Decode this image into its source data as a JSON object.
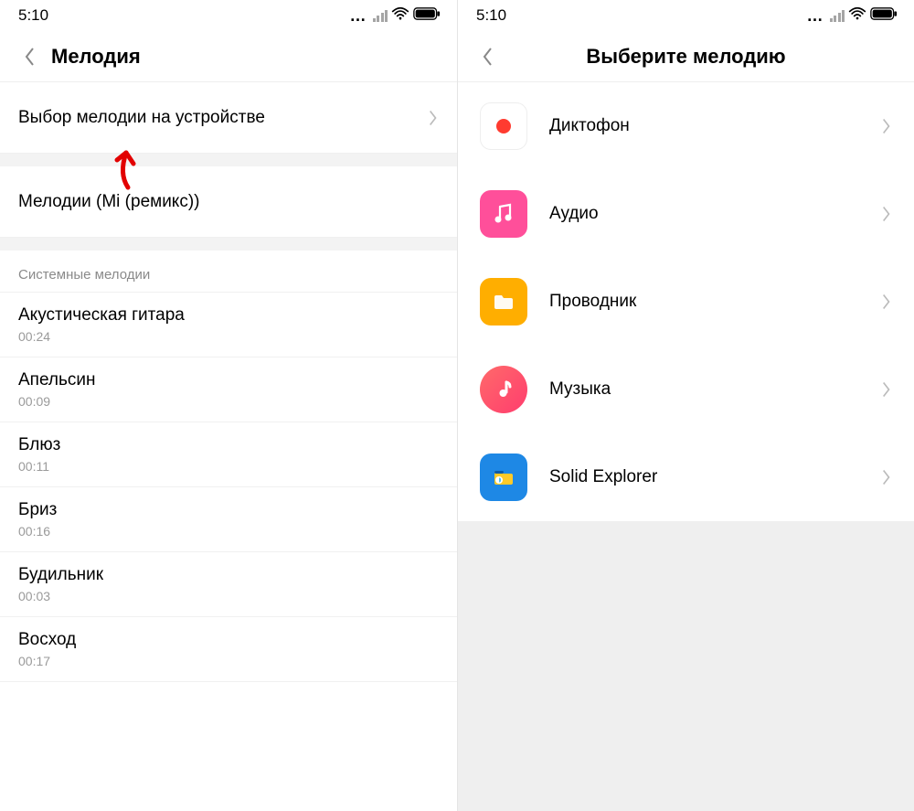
{
  "statusbar": {
    "time": "5:10"
  },
  "left": {
    "title": "Мелодия",
    "pick_on_device": "Выбор мелодии на устройстве",
    "mi_remix": "Мелодии (Mi (ремикс))",
    "section_system": "Системные мелодии",
    "tracks": [
      {
        "name": "Акустическая гитара",
        "dur": "00:24"
      },
      {
        "name": "Апельсин",
        "dur": "00:09"
      },
      {
        "name": "Блюз",
        "dur": "00:11"
      },
      {
        "name": "Бриз",
        "dur": "00:16"
      },
      {
        "name": "Будильник",
        "dur": "00:03"
      },
      {
        "name": "Восход",
        "dur": "00:17"
      }
    ]
  },
  "right": {
    "title": "Выберите мелодию",
    "apps": [
      {
        "name": "Диктофон",
        "icon": "recorder"
      },
      {
        "name": "Аудио",
        "icon": "audio"
      },
      {
        "name": "Проводник",
        "icon": "files"
      },
      {
        "name": "Музыка",
        "icon": "music"
      },
      {
        "name": "Solid Explorer",
        "icon": "solid"
      }
    ]
  }
}
